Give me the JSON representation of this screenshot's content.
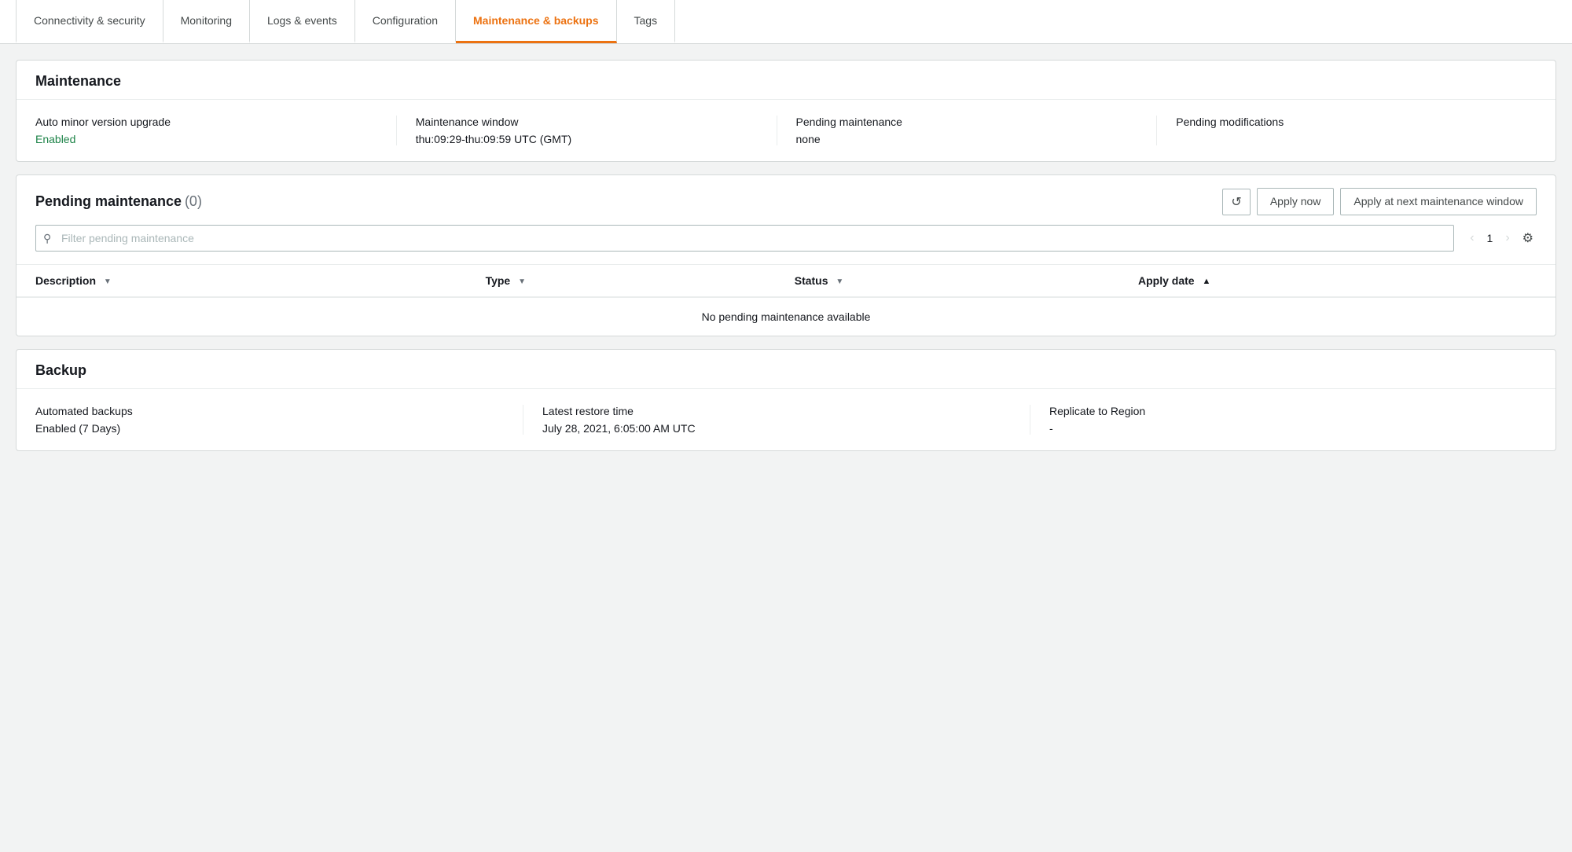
{
  "tabs": [
    {
      "id": "connectivity",
      "label": "Connectivity & security",
      "active": false
    },
    {
      "id": "monitoring",
      "label": "Monitoring",
      "active": false
    },
    {
      "id": "logs",
      "label": "Logs & events",
      "active": false
    },
    {
      "id": "configuration",
      "label": "Configuration",
      "active": false
    },
    {
      "id": "maintenance",
      "label": "Maintenance & backups",
      "active": true
    },
    {
      "id": "tags",
      "label": "Tags",
      "active": false
    }
  ],
  "maintenance_section": {
    "title": "Maintenance",
    "auto_minor": {
      "label": "Auto minor version upgrade",
      "value": "Enabled"
    },
    "maintenance_window": {
      "label": "Maintenance window",
      "value": "thu:09:29-thu:09:59 UTC (GMT)"
    },
    "pending_maintenance": {
      "label": "Pending maintenance",
      "value": "none"
    },
    "pending_modifications": {
      "label": "Pending modifications",
      "value": ""
    }
  },
  "pending_section": {
    "title": "Pending maintenance",
    "count": "(0)",
    "refresh_label": "↻",
    "apply_now_label": "Apply now",
    "apply_next_label": "Apply at next maintenance window",
    "search_placeholder": "Filter pending maintenance",
    "page_number": "1",
    "columns": [
      {
        "id": "description",
        "label": "Description",
        "sortable": true,
        "sort": "none"
      },
      {
        "id": "type",
        "label": "Type",
        "sortable": true,
        "sort": "none"
      },
      {
        "id": "status",
        "label": "Status",
        "sortable": true,
        "sort": "none"
      },
      {
        "id": "apply_date",
        "label": "Apply date",
        "sortable": true,
        "sort": "asc"
      }
    ],
    "empty_message": "No pending maintenance available"
  },
  "backup_section": {
    "title": "Backup",
    "automated_backups": {
      "label": "Automated backups",
      "value": "Enabled (7 Days)"
    },
    "latest_restore_time": {
      "label": "Latest restore time",
      "value": "July 28, 2021, 6:05:00 AM UTC"
    },
    "replicate_to_region": {
      "label": "Replicate to Region",
      "value": "-"
    }
  }
}
